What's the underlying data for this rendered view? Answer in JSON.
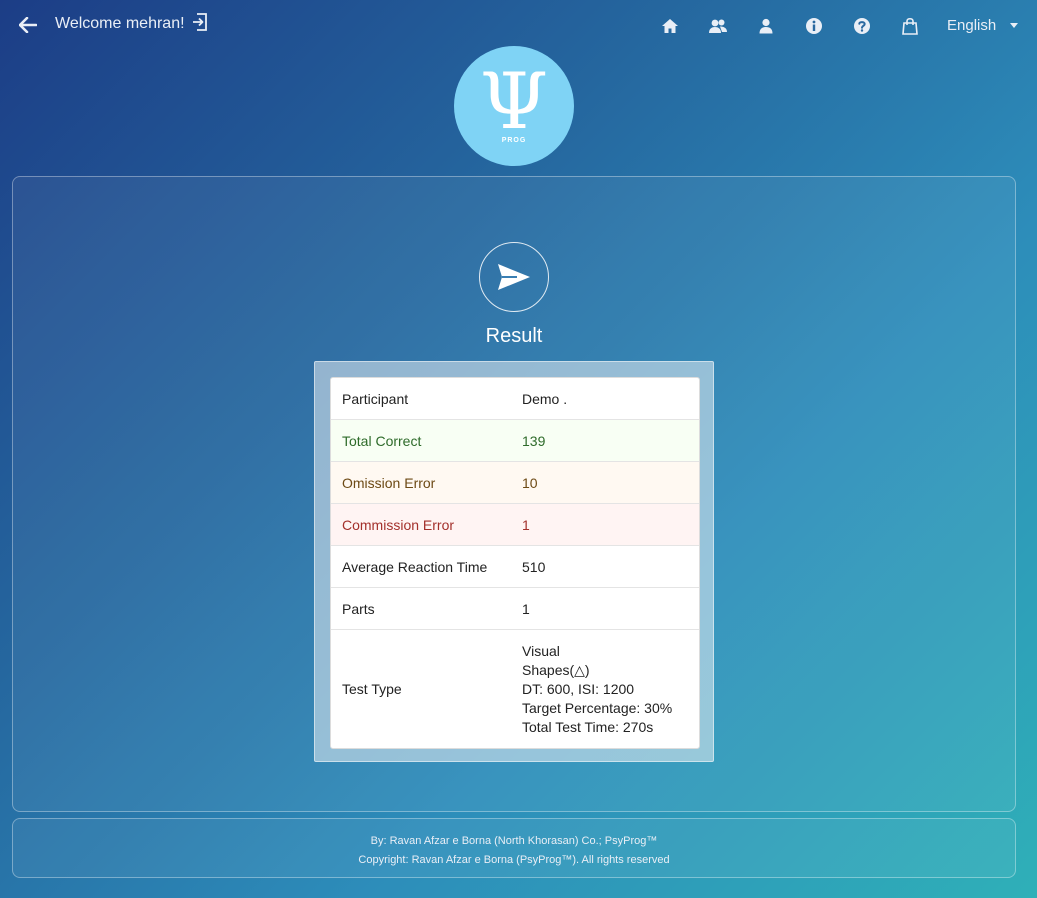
{
  "header": {
    "welcome_text": "Welcome mehran!",
    "language": "English",
    "icons": [
      "home-icon",
      "users-icon",
      "user-icon",
      "info-icon",
      "help-icon",
      "shopping-bag-icon"
    ]
  },
  "logo": {
    "symbol": "Ψ",
    "text": "PROG"
  },
  "main": {
    "title": "Result",
    "rows": [
      {
        "key": "Participant",
        "value": "Demo ."
      },
      {
        "key": "Total Correct",
        "value": "139"
      },
      {
        "key": "Omission Error",
        "value": "10"
      },
      {
        "key": "Commission Error",
        "value": "1"
      },
      {
        "key": "Average Reaction Time",
        "value": "510"
      },
      {
        "key": "Parts",
        "value": "1"
      },
      {
        "key": "Test Type",
        "lines": [
          "Visual",
          "Shapes(△)",
          "DT: 600, ISI: 1200",
          "Target Percentage: 30%",
          "Total Test Time: 270s"
        ]
      }
    ]
  },
  "footer": {
    "line1": "By: Ravan Afzar e Borna (North Khorasan) Co.; PsyProg™",
    "line2": "Copyright: Ravan Afzar e Borna (PsyProg™). All rights reserved"
  },
  "colors": {
    "accent_light": "#7fd3f5",
    "success_text": "#2e6b2a",
    "warning_text": "#6d4a15",
    "danger_text": "#a3302b"
  }
}
